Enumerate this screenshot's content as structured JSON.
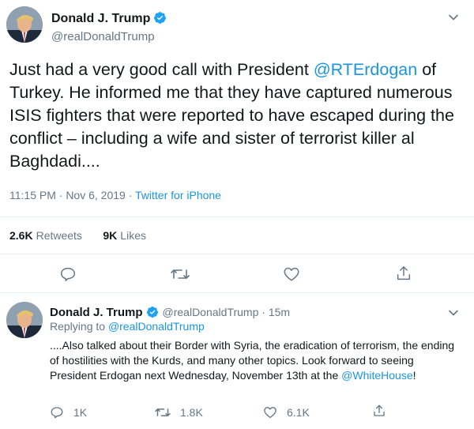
{
  "tweet1": {
    "name": "Donald J. Trump",
    "handle": "@realDonaldTrump",
    "text_before": "Just had a very good call with President ",
    "mention": "@RTErdogan",
    "text_after": " of Turkey. He informed me that they have captured numerous ISIS fighters that were reported to have escaped during the conflict – including a wife and sister of terrorist killer al Baghdadi....",
    "time": "11:15 PM · Nov 6, 2019",
    "sep": " · ",
    "source": "Twitter for iPhone",
    "retweets_count": "2.6K",
    "retweets_label": "Retweets",
    "likes_count": "9K",
    "likes_label": "Likes",
    "icons": [
      "reply-icon",
      "retweet-icon",
      "like-icon",
      "share-icon"
    ]
  },
  "tweet2": {
    "name": "Donald J. Trump",
    "handle": "@realDonaldTrump",
    "age": " · 15m",
    "replying_prefix": "Replying to ",
    "replying_to": "@realDonaldTrump",
    "text": "....Also talked about their Border with Syria, the eradication of terrorism, the ending of hostilities with the Kurds, and many other topics. Look forward to seeing President Erdogan next Wednesday, November 13th at the",
    "mention": "@WhiteHouse",
    "text_end": "!",
    "replies": "1K",
    "retweets": "1.8K",
    "likes": "6.1K"
  },
  "colors": {
    "link": "#1b95e0",
    "secondary": "#657786",
    "verified": "#1da1f2",
    "divider": "#e6ecf0"
  }
}
